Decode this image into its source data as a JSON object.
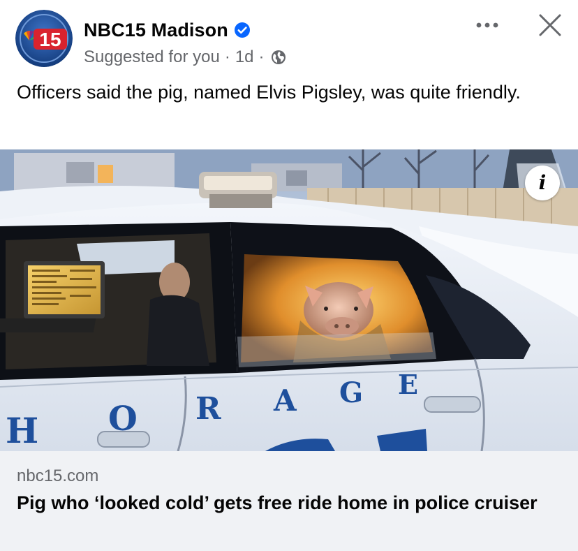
{
  "post": {
    "page_name": "NBC15 Madison",
    "verified": true,
    "suggested_label": "Suggested for you",
    "timestamp": "1d",
    "separator": "·",
    "audience_icon": "globe-icon",
    "avatar_logo_text": "15",
    "text": "Officers said the pig, named Elvis Pigsley, was quite friendly.",
    "more_icon": "more-options-icon",
    "close_icon": "close-icon"
  },
  "photo": {
    "alt": "Pig sitting in the back seat of a snowy police cruiser",
    "car_lettering": [
      "H",
      "O",
      "R",
      "A",
      "G",
      "E"
    ],
    "info_icon_label": "i"
  },
  "link_preview": {
    "domain": "nbc15.com",
    "title": "Pig who ‘looked cold’ gets free ride home in police cruiser"
  },
  "colors": {
    "verified_blue": "#0866ff",
    "secondary_text": "#65676b",
    "link_card_bg": "#f0f2f5",
    "logo_blue": "#1e4f9c",
    "logo_red": "#d9232e"
  }
}
